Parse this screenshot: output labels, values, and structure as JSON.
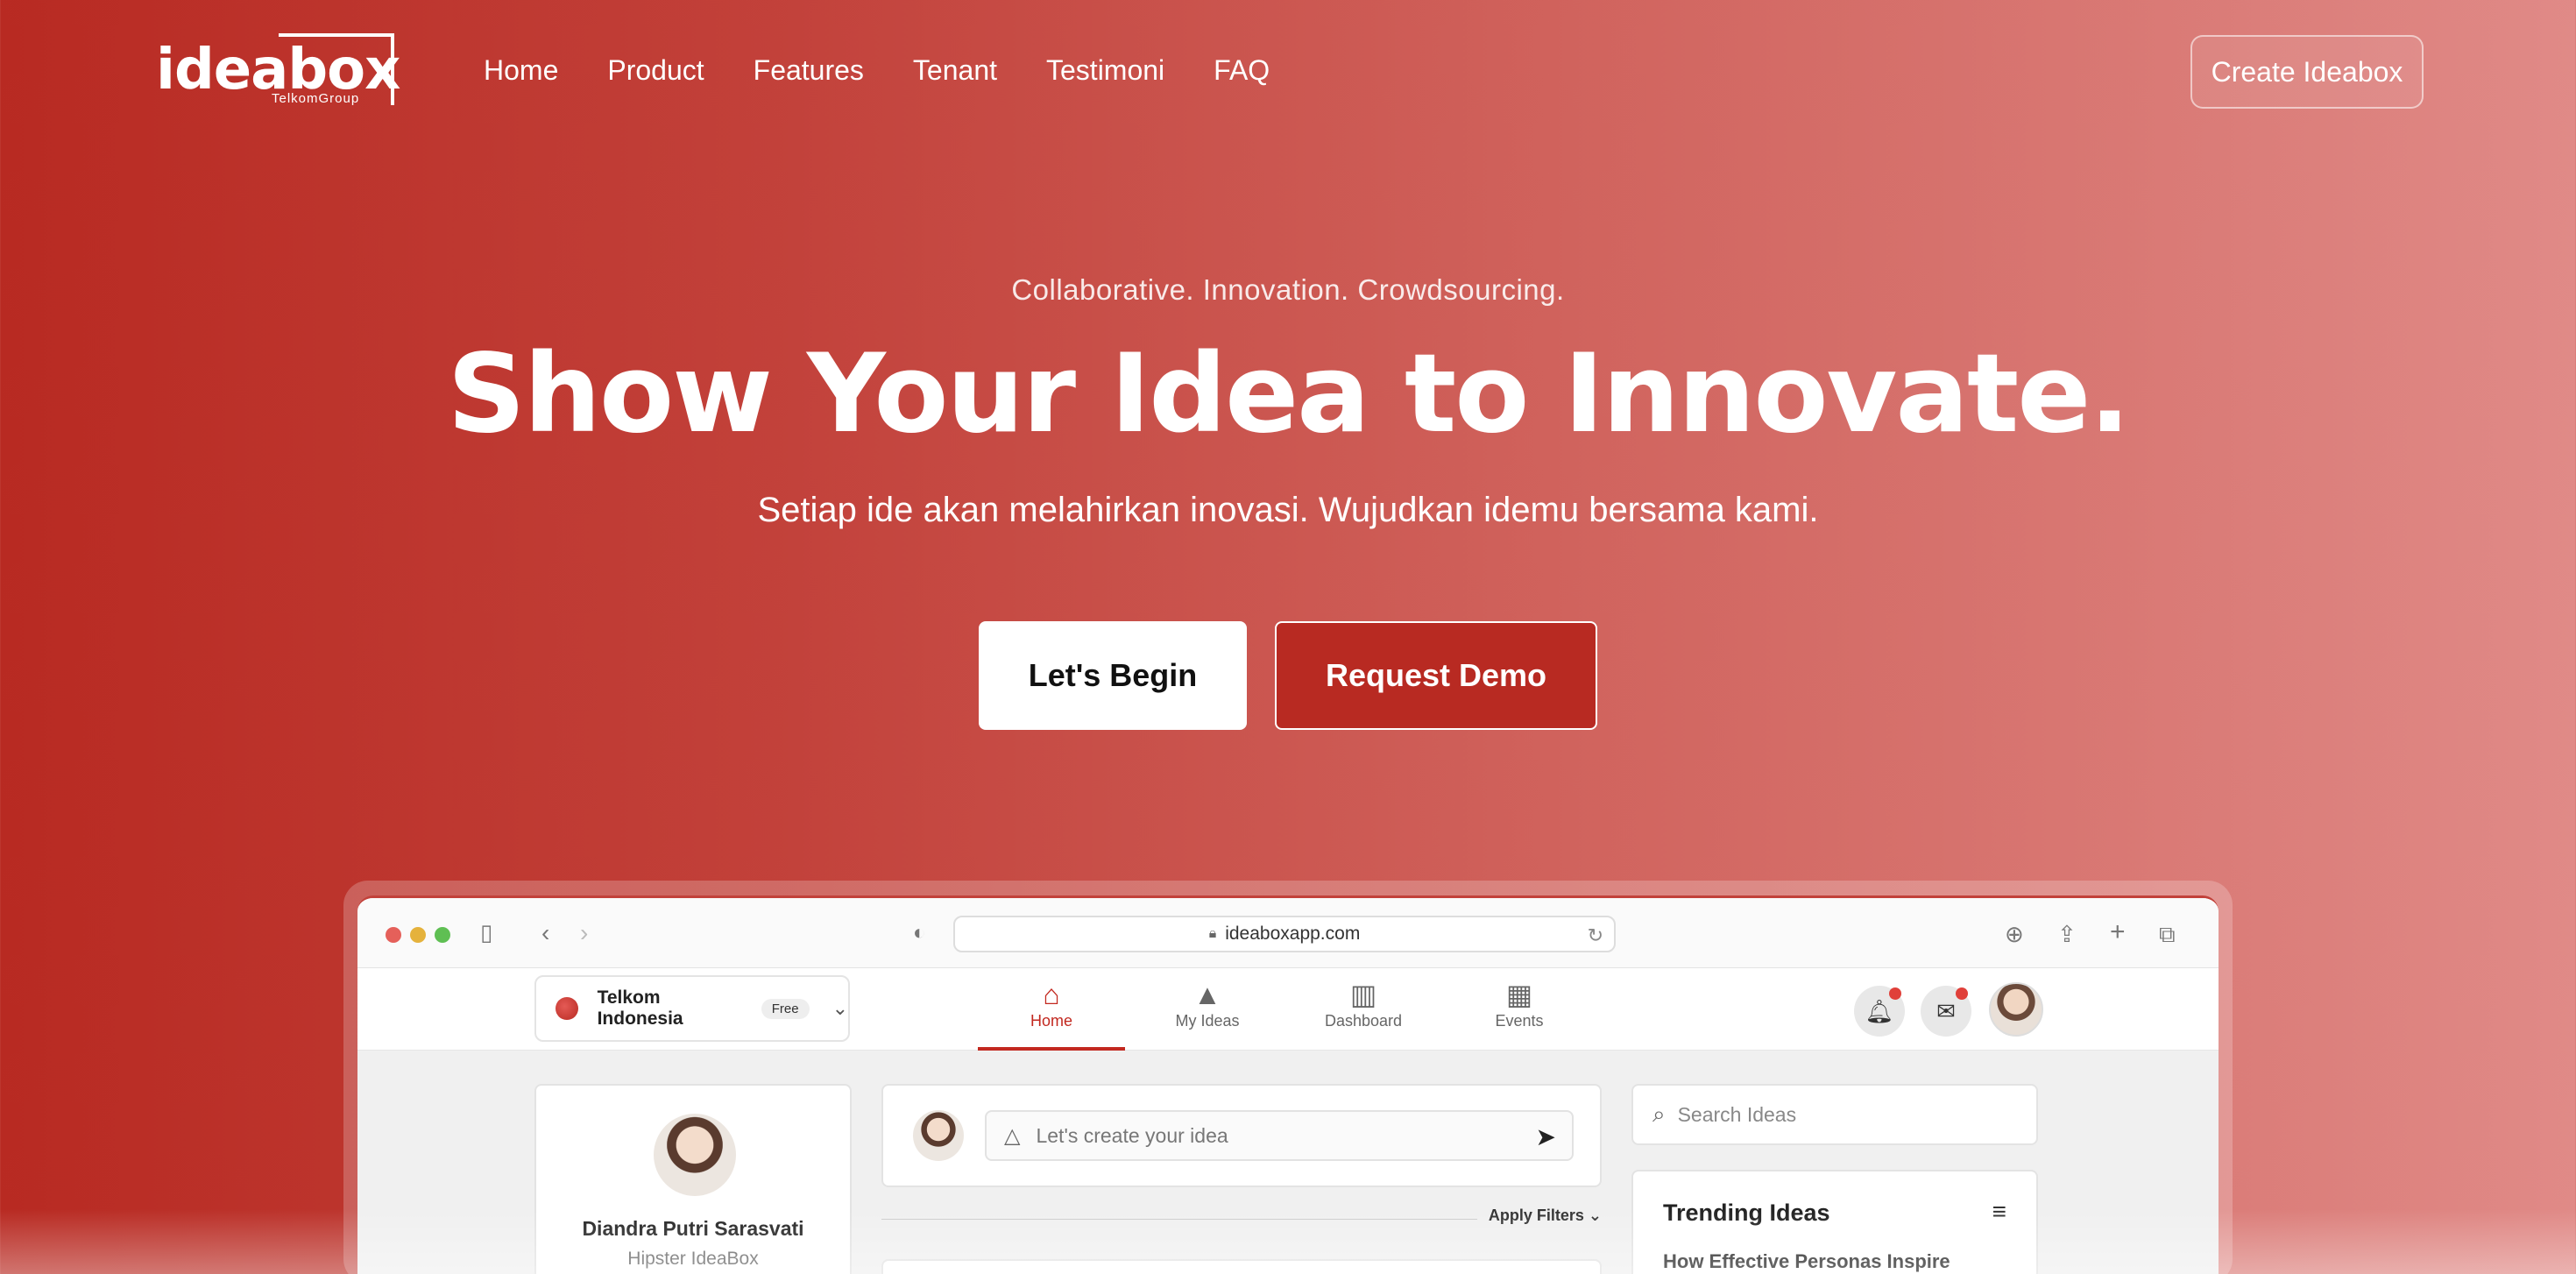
{
  "brand": {
    "logo_text": "ideabox",
    "logo_sub": "TelkomGroup"
  },
  "nav": {
    "links": [
      "Home",
      "Product",
      "Features",
      "Tenant",
      "Testimoni",
      "FAQ"
    ],
    "cta": "Create Ideabox"
  },
  "hero": {
    "tagline": "Collaborative. Innovation. Crowdsourcing.",
    "headline": "Show Your Idea to Innovate.",
    "subtitle": "Setiap ide akan melahirkan inovasi. Wujudkan idemu bersama kami.",
    "primary_button": "Let's Begin",
    "secondary_button": "Request Demo"
  },
  "mockup": {
    "url": "ideaboxapp.com",
    "org": {
      "name": "Telkom Indonesia",
      "plan": "Free"
    },
    "tabs": [
      {
        "label": "Home",
        "icon": "home-icon",
        "active": true
      },
      {
        "label": "My Ideas",
        "icon": "shapes-icon",
        "active": false
      },
      {
        "label": "Dashboard",
        "icon": "bar-chart-icon",
        "active": false
      },
      {
        "label": "Events",
        "icon": "calendar-icon",
        "active": false
      }
    ],
    "profile": {
      "name": "Diandra Putri Sarasvati",
      "role": "Hipster IdeaBox"
    },
    "composer": {
      "placeholder": "Let's create your idea"
    },
    "filters_label": "Apply Filters",
    "search": {
      "placeholder": "Search Ideas"
    },
    "trending": {
      "title": "Trending Ideas",
      "first_item": "How Effective Personas Inspire"
    }
  },
  "colors": {
    "primary_red": "#b82a22",
    "gradient_end": "#e08a87",
    "active_tab": "#c2281f",
    "notification_dot": "#e0403a"
  }
}
